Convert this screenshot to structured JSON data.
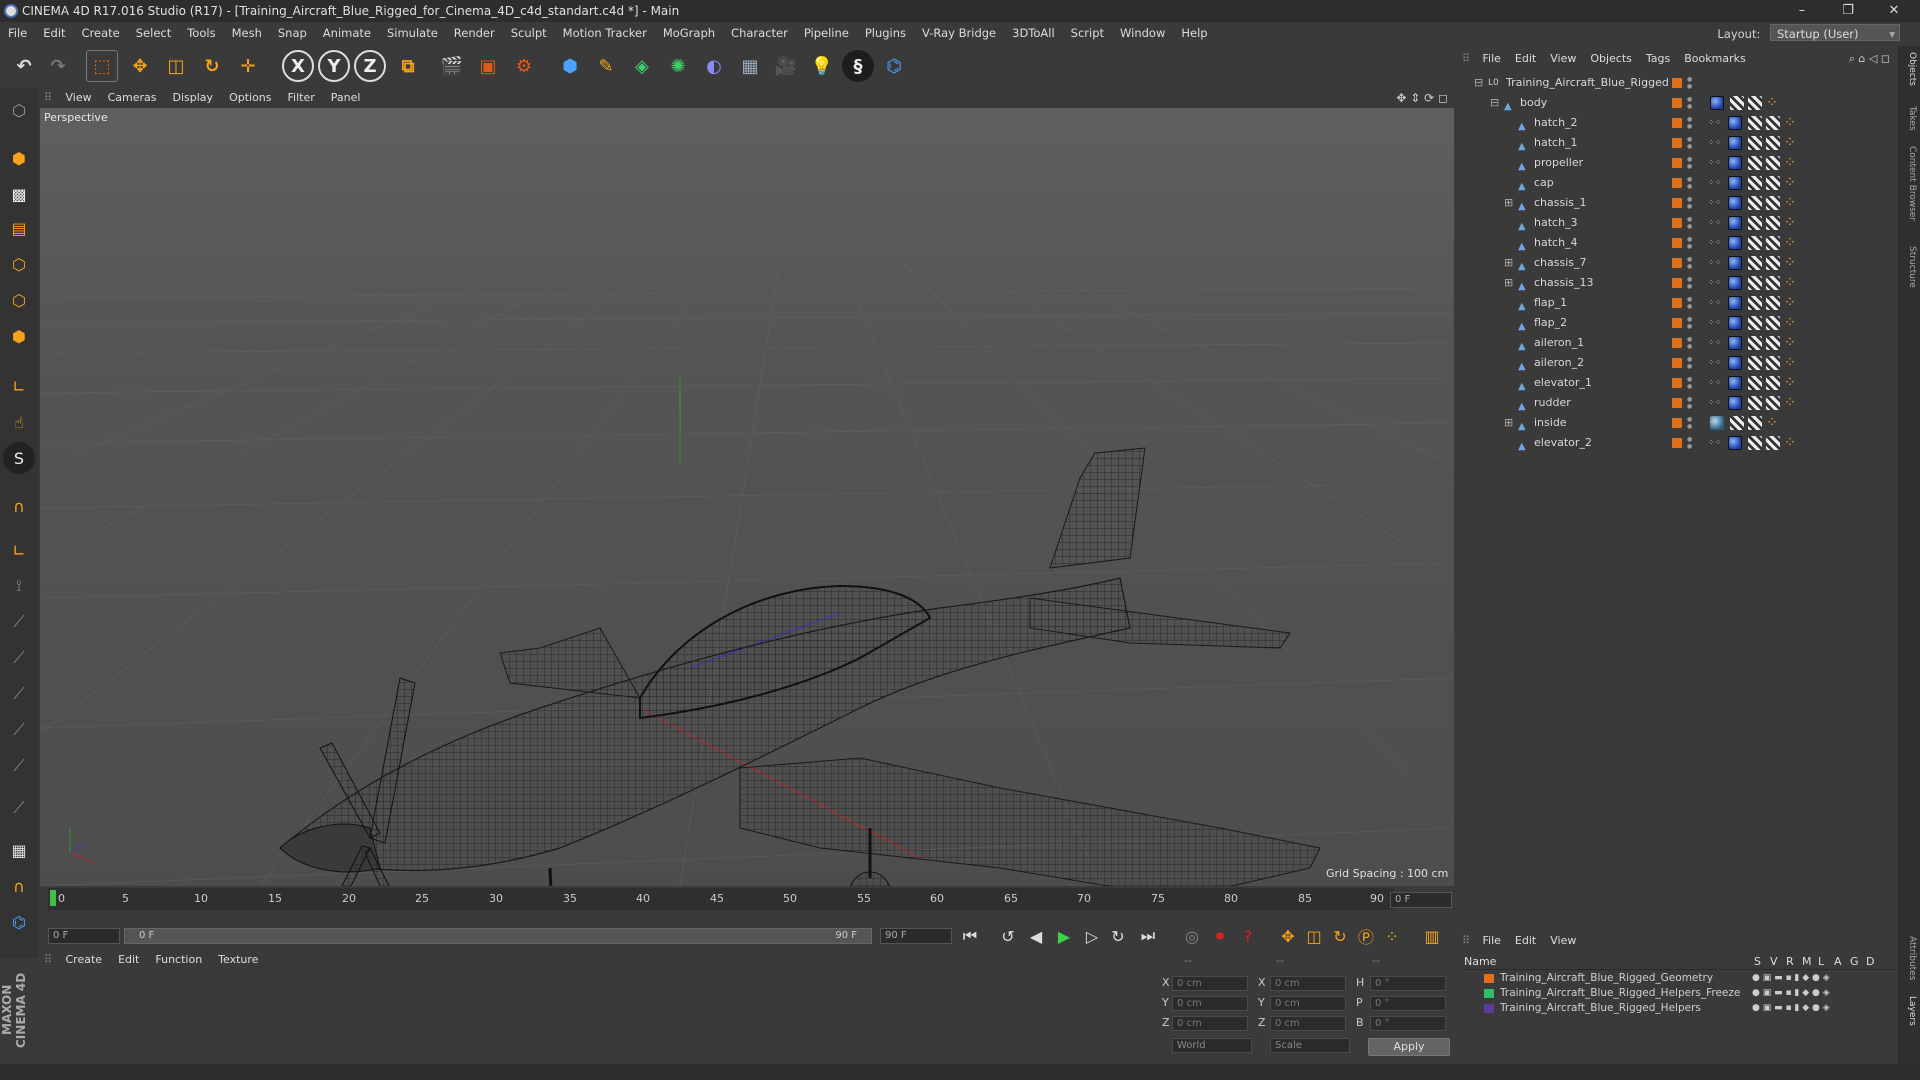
{
  "window": {
    "title": "CINEMA 4D R17.016 Studio (R17) - [Training_Aircraft_Blue_Rigged_for_Cinema_4D_c4d_standart.c4d *] - Main",
    "layout_label": "Layout:",
    "layout_value": "Startup (User)"
  },
  "menubar": [
    "File",
    "Edit",
    "Create",
    "Select",
    "Tools",
    "Mesh",
    "Snap",
    "Animate",
    "Simulate",
    "Render",
    "Sculpt",
    "Motion Tracker",
    "MoGraph",
    "Character",
    "Pipeline",
    "Plugins",
    "V-Ray Bridge",
    "3DToAll",
    "Script",
    "Window",
    "Help"
  ],
  "toolbar": {
    "axis_x": "X",
    "axis_y": "Y",
    "axis_z": "Z"
  },
  "viewport": {
    "menu": [
      "View",
      "Cameras",
      "Display",
      "Options",
      "Filter",
      "Panel"
    ],
    "label": "Perspective",
    "grid_spacing": "Grid Spacing : 100 cm"
  },
  "timeline": {
    "ticks": [
      "0",
      "5",
      "10",
      "15",
      "20",
      "25",
      "30",
      "35",
      "40",
      "45",
      "50",
      "55",
      "60",
      "65",
      "70",
      "75",
      "80",
      "85",
      "90"
    ],
    "current_frame_display": "0 F",
    "start_field": "0 F",
    "range_start": "0 F",
    "range_end": "90 F",
    "end_field": "90 F"
  },
  "material_manager": {
    "menu": [
      "Create",
      "Edit",
      "Function",
      "Texture"
    ]
  },
  "coordinates": {
    "row_labels": [
      "X",
      "Y",
      "Z"
    ],
    "pos_values": [
      "0 cm",
      "0 cm",
      "0 cm"
    ],
    "size_labels": [
      "X",
      "Y",
      "Z"
    ],
    "size_values": [
      "0 cm",
      "0 cm",
      "0 cm"
    ],
    "rot_labels": [
      "H",
      "P",
      "B"
    ],
    "rot_values": [
      "0 °",
      "0 °",
      "0 °"
    ],
    "mode_world": "World",
    "mode_scale": "Scale",
    "apply": "Apply",
    "header_dashes": [
      "--",
      "--",
      "--"
    ]
  },
  "object_manager": {
    "menu": [
      "File",
      "Edit",
      "View",
      "Objects",
      "Tags",
      "Bookmarks"
    ],
    "root": "Training_Aircraft_Blue_Rigged",
    "body": "body",
    "children": [
      "hatch_2",
      "hatch_1",
      "propeller",
      "cap",
      "chassis_1",
      "hatch_3",
      "hatch_4",
      "chassis_7",
      "chassis_13",
      "flap_1",
      "flap_2",
      "aileron_1",
      "aileron_2",
      "elevator_1",
      "rudder",
      "inside",
      "elevator_2"
    ]
  },
  "layer_manager": {
    "menu": [
      "File",
      "Edit",
      "View"
    ],
    "columns": {
      "name": "Name",
      "flags": [
        "S",
        "V",
        "R",
        "M",
        "L",
        "A",
        "G",
        "D"
      ]
    },
    "layers": [
      {
        "name": "Training_Aircraft_Blue_Rigged_Geometry",
        "color": "#e0701a"
      },
      {
        "name": "Training_Aircraft_Blue_Rigged_Helpers_Freeze",
        "color": "#2fbf6a"
      },
      {
        "name": "Training_Aircraft_Blue_Rigged_Helpers",
        "color": "#5a3a9a"
      }
    ]
  },
  "side_tabs": [
    "Objects",
    "Takes",
    "Content Browser",
    "Structure",
    "Attributes",
    "Layers"
  ],
  "branding": "MAXON CINEMA 4D"
}
